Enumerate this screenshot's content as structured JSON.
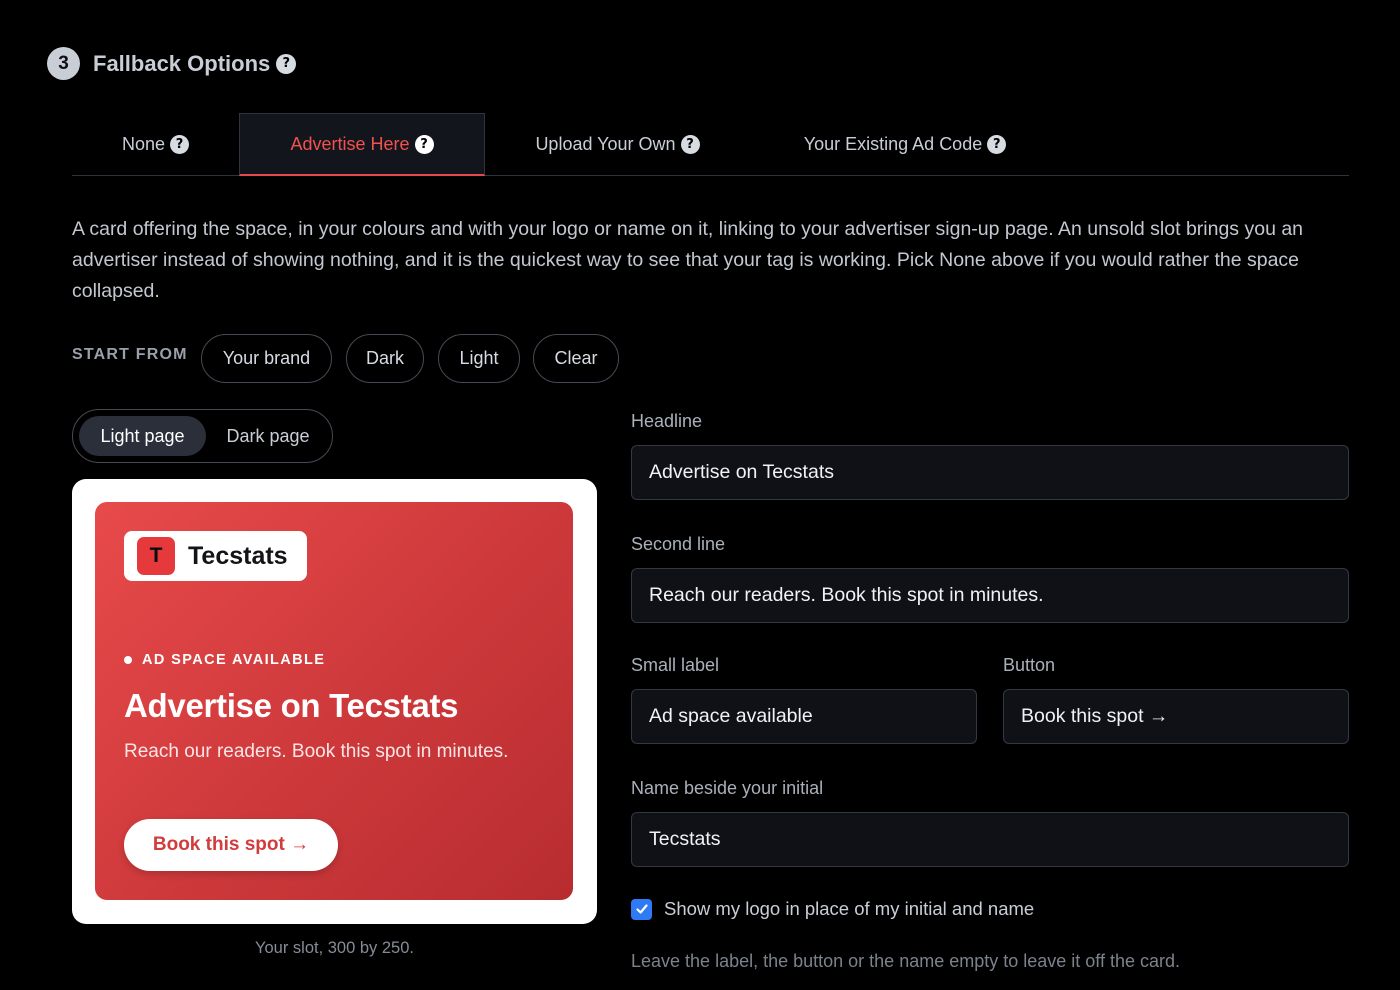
{
  "section": {
    "step": "3",
    "title": "Fallback Options",
    "help_icon": "?"
  },
  "tabs": [
    {
      "label": "None",
      "active": false
    },
    {
      "label": "Advertise Here",
      "active": true
    },
    {
      "label": "Upload Your Own",
      "active": false
    },
    {
      "label": "Your Existing Ad Code",
      "active": false
    }
  ],
  "description": "A card offering the space, in your colours and with your logo or name on it, linking to your advertiser sign-up page. An unsold slot brings you an advertiser instead of showing nothing, and it is the quickest way to see that your tag is working. Pick None above if you would rather the space collapsed.",
  "start_from": {
    "label": "START FROM",
    "options": [
      "Your brand",
      "Dark",
      "Light",
      "Clear"
    ]
  },
  "page_toggle": {
    "options": [
      "Light page",
      "Dark page"
    ],
    "selected": "Light page"
  },
  "preview": {
    "brand_initial": "T",
    "brand_name": "Tecstats",
    "label": "AD SPACE AVAILABLE",
    "headline": "Advertise on Tecstats",
    "sub": "Reach our readers. Book this spot in minutes.",
    "button": "Book this spot →",
    "caption": "Your slot, 300 by 250."
  },
  "form": {
    "headline": {
      "label": "Headline",
      "value": "Advertise on Tecstats"
    },
    "second_line": {
      "label": "Second line",
      "value": "Reach our readers. Book this spot in minutes."
    },
    "small_label": {
      "label": "Small label",
      "value": "Ad space available"
    },
    "button": {
      "label": "Button",
      "value": "Book this spot →"
    },
    "name": {
      "label": "Name beside your initial",
      "value": "Tecstats"
    },
    "show_logo": {
      "label": "Show my logo in place of my initial and name",
      "checked": true
    },
    "hint": "Leave the label, the button or the name empty to leave it off the card."
  },
  "colors": {
    "accent": "#e5484d",
    "card_gradient_start": "#e84a4a",
    "card_gradient_end": "#b72c30",
    "checkbox": "#2f7bf5"
  }
}
